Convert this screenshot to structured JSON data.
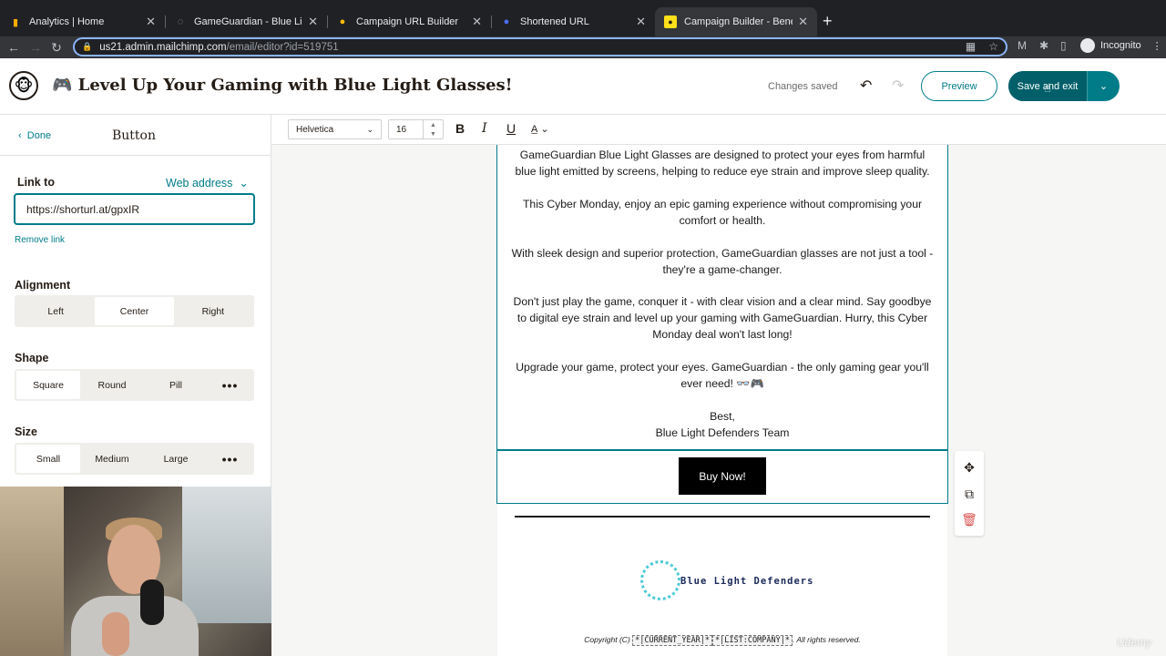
{
  "browser": {
    "tabs": [
      {
        "title": "Analytics | Home",
        "icon": "bar-chart-icon",
        "color": "#f9ab00"
      },
      {
        "title": "GameGuardian - Blue Light De",
        "icon": "loading-icon",
        "color": "#5f6368"
      },
      {
        "title": "Campaign URL Builder",
        "icon": "builder-icon",
        "color": "#fbbc04"
      },
      {
        "title": "Shortened URL",
        "icon": "link-icon",
        "color": "#4c6ef5"
      },
      {
        "title": "Campaign Builder - Benefit of",
        "icon": "mailchimp-icon",
        "color": "#ffe01b"
      }
    ],
    "url_host": "us21.admin.mailchimp.com",
    "url_path": "/email/editor?id=519751",
    "profile": "Incognito"
  },
  "header": {
    "campaign_title": "🎮 Level Up Your Gaming with Blue Light Glasses!",
    "status": "Changes saved",
    "preview_label": "Preview",
    "save_label": "Save and exit"
  },
  "panel": {
    "done_label": "Done",
    "title": "Button",
    "link_to_label": "Link to",
    "link_type": "Web address",
    "link_value": "https://shorturl.at/gpxIR",
    "remove_link": "Remove link",
    "alignment": {
      "label": "Alignment",
      "options": [
        "Left",
        "Center",
        "Right"
      ],
      "selected": "Center"
    },
    "shape": {
      "label": "Shape",
      "options": [
        "Square",
        "Round",
        "Pill"
      ],
      "selected": "Square"
    },
    "size": {
      "label": "Size",
      "options": [
        "Small",
        "Medium",
        "Large"
      ],
      "selected": "Small"
    }
  },
  "toolbar": {
    "font": "Helvetica",
    "font_size": "16"
  },
  "email": {
    "paragraphs": [
      "GameGuardian Blue Light Glasses are designed to protect your eyes from harmful blue light emitted by screens, helping to reduce eye strain and improve sleep quality.",
      "This Cyber Monday, enjoy an epic gaming experience without compromising your comfort or health.",
      "With sleek design and superior protection, GameGuardian glasses are not just a tool - they're a game-changer.",
      "Don't just play the game, conquer it - with clear vision and a clear mind. Say goodbye to digital eye strain and level up your gaming with GameGuardian. Hurry, this Cyber Monday deal won't last long!",
      "Upgrade your game, protect your eyes. GameGuardian - the only gaming gear you'll ever need! 👓🎮"
    ],
    "signoff": "Best,",
    "signature": "Blue Light Defenders Team",
    "button_label": "Buy Now!",
    "brand_name": "Blue Light Defenders",
    "copyright_prefix": "Copyright (C)",
    "merge_year": "*|CURRENT_YEAR|*",
    "merge_company": "*|LIST:COMPANY|*",
    "copyright_suffix": "All rights reserved."
  },
  "colors": {
    "accent": "#007c89",
    "accent_dark": "#005f69"
  },
  "watermark": "Udemy"
}
